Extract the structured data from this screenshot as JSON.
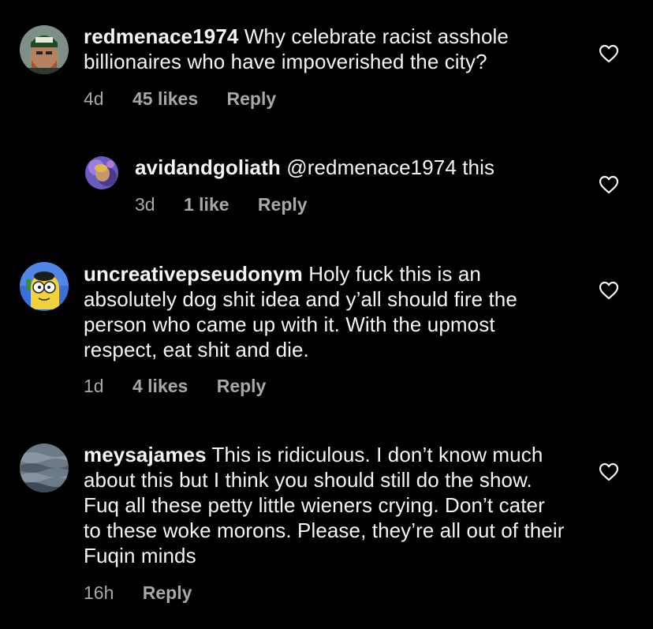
{
  "comments": [
    {
      "username": "redmenace1974",
      "text": " Why celebrate racist asshole billionaires who have impoverished the city?",
      "time": "4d",
      "likes": "45 likes",
      "reply": "Reply",
      "avatar_icon": "avatar-photo-icon",
      "heart_icon": "heart-outline-icon"
    },
    {
      "username": "avidandgoliath",
      "text": " @redmenace1974 this",
      "time": "3d",
      "likes": "1 like",
      "reply": "Reply",
      "avatar_icon": "avatar-photo-icon",
      "heart_icon": "heart-outline-icon"
    },
    {
      "username": "uncreativepseudonym",
      "text": " Holy fuck this is an absolutely dog shit idea and y’all should fire the person who came up with it. With the upmost respect, eat shit and die.",
      "time": "1d",
      "likes": "4 likes",
      "reply": "Reply",
      "avatar_icon": "avatar-cartoon-icon",
      "heart_icon": "heart-outline-icon"
    },
    {
      "username": "meysajames",
      "text": " This is ridiculous. I don’t know much about this but I think you should still do the show. Fuq all these petty little wieners crying. Don’t cater to these woke morons. Please, they’re all out of their Fuqin minds",
      "time": "16h",
      "reply": "Reply",
      "avatar_icon": "avatar-water-icon",
      "heart_icon": "heart-outline-icon"
    }
  ],
  "colors": {
    "background": "#000000",
    "text": "#f5f5f5",
    "secondary": "#a8a8a8"
  }
}
